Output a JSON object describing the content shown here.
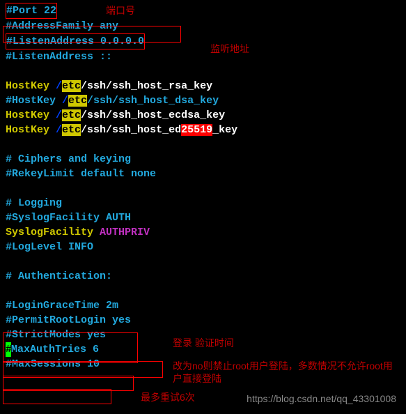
{
  "lines": {
    "l1": "#Port 22",
    "l2": "#AddressFamily any",
    "l3": "#ListenAddress 0.0.0.0",
    "l4": "#ListenAddress ::",
    "l5_pre": "HostKey ",
    "l5_mid": "/ssh/ssh_host_rsa_key",
    "l6_pre": "#HostKey ",
    "l6_mid": "/ssh/ssh_host_dsa_key",
    "l7_pre": "HostKey ",
    "l7_mid": "/ssh/ssh_host_ecdsa_key",
    "l8_pre": "HostKey ",
    "l8_mid": "/ssh/ssh_host_ed",
    "l8_post": "_key",
    "slash": "/",
    "etc": "etc",
    "num25519": "25519",
    "l9": "# Ciphers and keying",
    "l10": "#RekeyLimit default none",
    "l11": "# Logging",
    "l12": "#SyslogFacility AUTH",
    "l13a": "SyslogFacility ",
    "l13b": "AUTHPRIV",
    "l14": "#LogLevel INFO",
    "l15": "# Authentication:",
    "l16": "#LoginGraceTime 2m",
    "l17": "#PermitRootLogin yes",
    "l18": "#StrictModes yes",
    "l19a": "#",
    "l19b": "MaxAuthTries 6",
    "l20a": "#",
    "l20b": "MaxSessions 10"
  },
  "annotations": {
    "a1": "端口号",
    "a2": "监听地址",
    "a3": "登录 验证时间",
    "a4": "改为no则禁止root用户登陆，多数情况不允许root用户直接登陆",
    "a5": "最多重试6次"
  },
  "watermark": "https://blog.csdn.net/qq_43301008"
}
